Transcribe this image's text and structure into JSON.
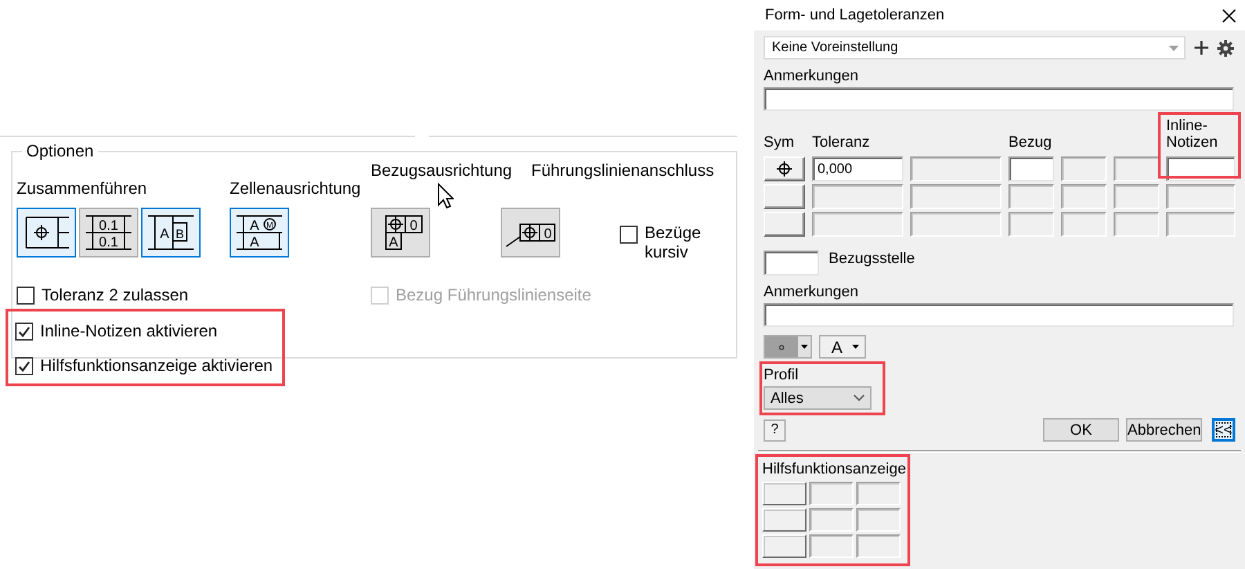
{
  "options": {
    "title": "Optionen",
    "groups": [
      {
        "label": "Zusammenführen",
        "buttons": [
          {
            "kind": "symbol",
            "selected": true
          },
          {
            "kind": "stacked",
            "selected": false,
            "texts": [
              "0.1",
              "0.1"
            ]
          },
          {
            "kind": "split",
            "selected": true,
            "texts": [
              "A",
              "B"
            ]
          }
        ]
      },
      {
        "label": "Zellenausrichtung",
        "buttons": [
          {
            "kind": "cell-align",
            "selected": true,
            "texts": [
              "A",
              "M",
              "A"
            ]
          }
        ]
      },
      {
        "label": "Bezugsausrichtung",
        "buttons": [
          {
            "kind": "datum-corner",
            "selected": false,
            "texts": [
              "0",
              "A"
            ]
          }
        ]
      },
      {
        "label": "Führungslinienanschluss",
        "buttons": [
          {
            "kind": "leader",
            "selected": false,
            "texts": [
              "0"
            ]
          }
        ]
      }
    ],
    "italic_refs": {
      "label": "Bezüge kursiv",
      "checked": false
    },
    "checkboxes": [
      {
        "label": "Toleranz 2 zulassen",
        "checked": false,
        "disabled": false,
        "highlighted": false
      },
      {
        "label": "Bezug Führungslinienseite",
        "checked": false,
        "disabled": true,
        "highlighted": false
      },
      {
        "label": "Inline-Notizen aktivieren",
        "checked": true,
        "disabled": false,
        "highlighted": true
      },
      {
        "label": "Hilfsfunktionsanzeige aktivieren",
        "checked": true,
        "disabled": false,
        "highlighted": true
      }
    ]
  },
  "dialog": {
    "title": "Form- und Lagetoleranzen",
    "preset": {
      "value": "Keine Voreinstellung"
    },
    "notes_top": {
      "label": "Anmerkungen"
    },
    "frame": {
      "columns": [
        {
          "kind": "sym",
          "label": "Sym"
        },
        {
          "kind": "tolerance",
          "label": "Toleranz"
        },
        {
          "kind": "datum",
          "label": "Bezug"
        },
        {
          "kind": "inline",
          "label": "Inline-Notizen",
          "highlighted": true
        }
      ],
      "rows": [
        {
          "cells": [
            {
              "kind": "position-symbol"
            },
            {
              "kind": "field",
              "enabled": true,
              "value": "0,000"
            },
            {
              "kind": "field",
              "enabled": false
            },
            {
              "kind": "field",
              "enabled": true
            },
            {
              "kind": "field",
              "enabled": false
            },
            {
              "kind": "field",
              "enabled": false
            },
            {
              "kind": "field",
              "enabled": true
            }
          ]
        },
        {
          "cells": [
            {
              "kind": "symbol"
            },
            {
              "kind": "field",
              "enabled": false
            },
            {
              "kind": "field",
              "enabled": false
            },
            {
              "kind": "field",
              "enabled": false
            },
            {
              "kind": "field",
              "enabled": false
            },
            {
              "kind": "field",
              "enabled": false
            },
            {
              "kind": "field",
              "enabled": false
            }
          ]
        },
        {
          "cells": [
            {
              "kind": "symbol"
            },
            {
              "kind": "field",
              "enabled": false
            },
            {
              "kind": "field",
              "enabled": false
            },
            {
              "kind": "field",
              "enabled": false
            },
            {
              "kind": "field",
              "enabled": false
            },
            {
              "kind": "field",
              "enabled": false
            },
            {
              "kind": "field",
              "enabled": false
            }
          ]
        }
      ]
    },
    "datum_point": {
      "label": "Bezugsstelle"
    },
    "notes_bottom": {
      "label": "Anmerkungen"
    },
    "font_button": {
      "text": "A"
    },
    "profile": {
      "label": "Profil",
      "value": "Alles",
      "highlighted": true
    },
    "help": {
      "text": "?"
    },
    "buttons": [
      {
        "label": "OK",
        "focused": false
      },
      {
        "label": "Abbrechen",
        "focused": false
      },
      {
        "label": "<<",
        "focused": true
      }
    ],
    "helper": {
      "label": "Hilfsfunktionsanzeige",
      "highlighted": true
    }
  }
}
